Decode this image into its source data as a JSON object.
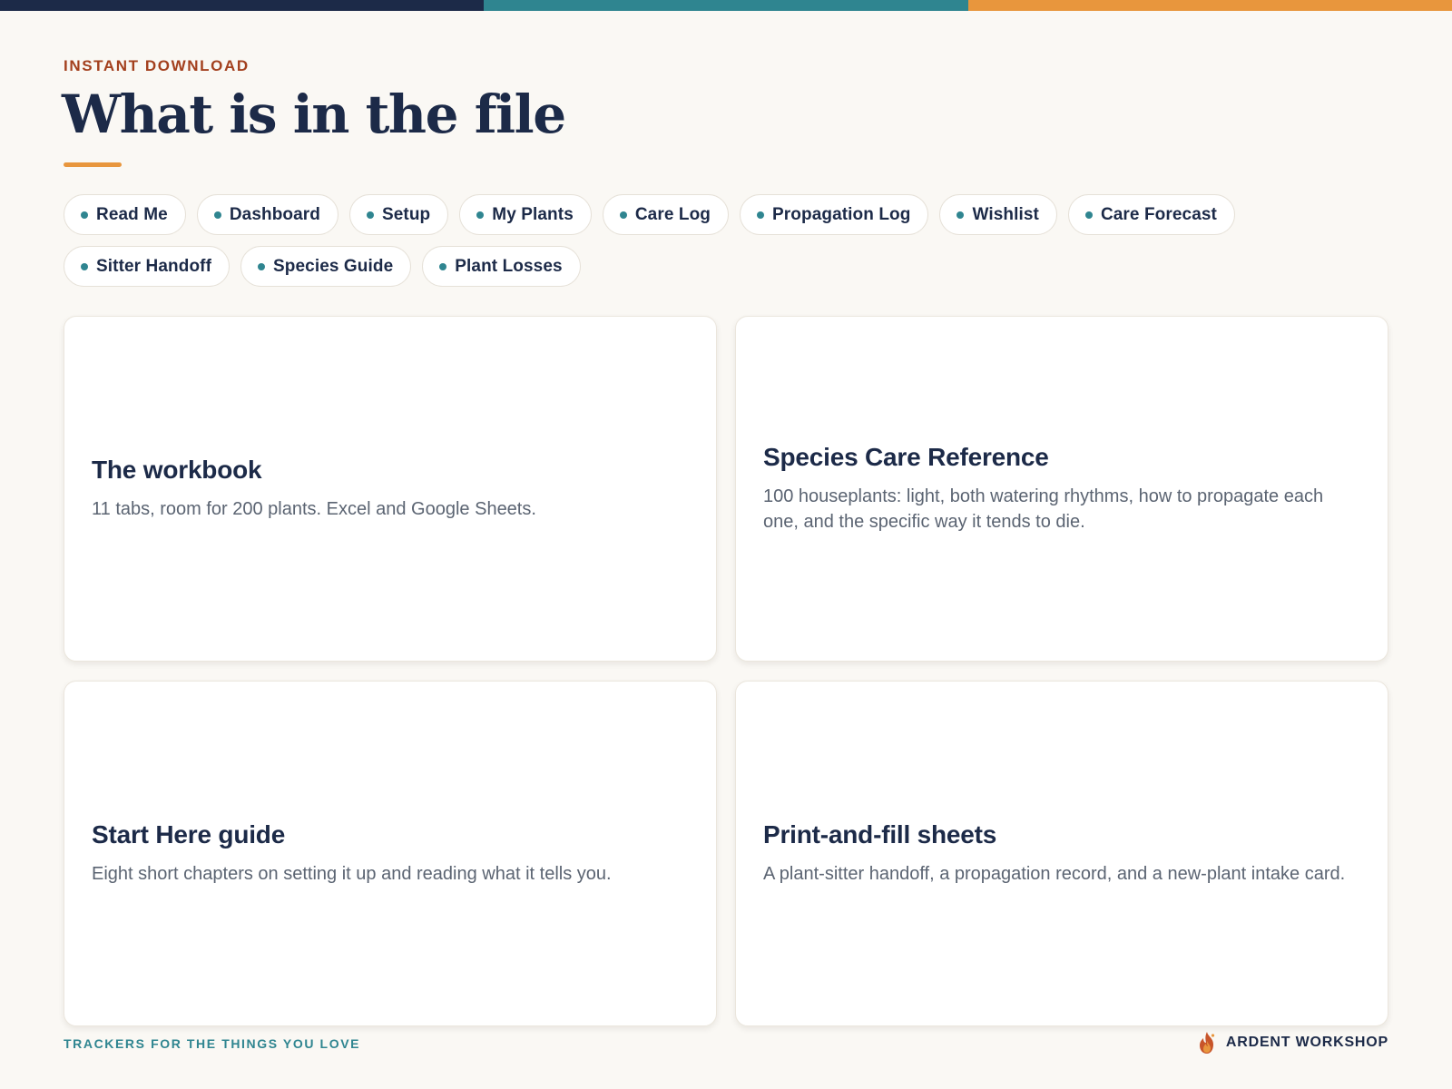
{
  "colors": {
    "navy": "#1c2a48",
    "teal": "#2f8590",
    "orange": "#e8963d",
    "rust": "#a3401e",
    "background": "#faf8f4"
  },
  "top_bar": {
    "segments": [
      "#1c2a48",
      "#2f8590",
      "#e8963d"
    ]
  },
  "header": {
    "eyebrow": "INSTANT DOWNLOAD",
    "title": "What is in the file"
  },
  "tabs": [
    {
      "label": "Read Me"
    },
    {
      "label": "Dashboard"
    },
    {
      "label": "Setup"
    },
    {
      "label": "My Plants"
    },
    {
      "label": "Care Log"
    },
    {
      "label": "Propagation Log"
    },
    {
      "label": "Wishlist"
    },
    {
      "label": "Care Forecast"
    },
    {
      "label": "Sitter Handoff"
    },
    {
      "label": "Species Guide"
    },
    {
      "label": "Plant Losses"
    }
  ],
  "cards": [
    {
      "title": "The workbook",
      "description": "11 tabs, room for 200 plants. Excel and Google Sheets."
    },
    {
      "title": "Species Care Reference",
      "description": "100 houseplants: light, both watering rhythms, how to propagate each one, and the specific way it tends to die."
    },
    {
      "title": "Start Here guide",
      "description": "Eight short chapters on setting it up and reading what it tells you."
    },
    {
      "title": "Print-and-fill sheets",
      "description": "A plant-sitter handoff, a propagation record, and a new-plant intake card."
    }
  ],
  "footer": {
    "tagline": "TRACKERS FOR THE THINGS YOU LOVE",
    "brand": "ARDENT WORKSHOP",
    "brand_icon": "flame-icon"
  }
}
